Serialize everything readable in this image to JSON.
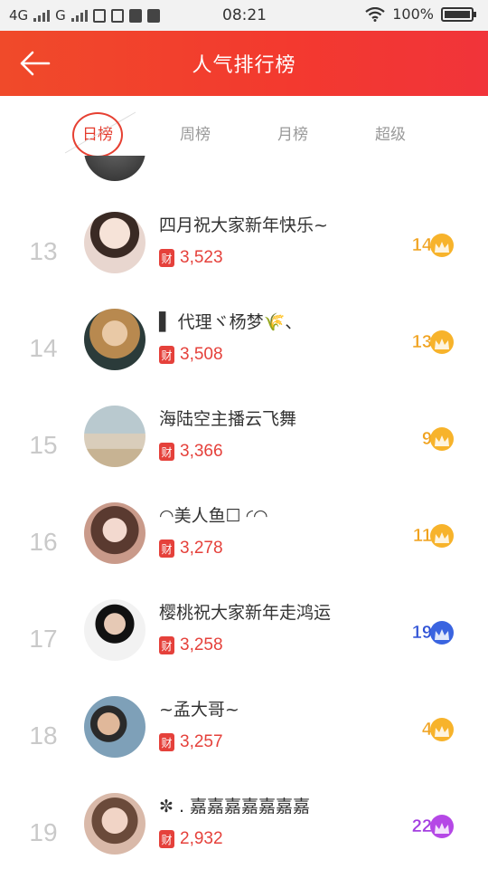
{
  "status_bar": {
    "net1": "4G",
    "net2": "G",
    "time": "08:21",
    "battery": "100%",
    "battery_level": 1.0
  },
  "header": {
    "title": "人气排行榜"
  },
  "tabs": [
    {
      "label": "日榜",
      "active": true
    },
    {
      "label": "周榜",
      "active": false
    },
    {
      "label": "月榜",
      "active": false
    },
    {
      "label": "超级",
      "active": false
    }
  ],
  "ranking": [
    {
      "rank": "13",
      "name": "四月祝大家新年快乐~",
      "value": "3,523",
      "level": "14",
      "tier": "gold"
    },
    {
      "rank": "14",
      "name": "▌ 代理ヾ杨梦🌾、",
      "value": "3,508",
      "level": "13",
      "tier": "gold"
    },
    {
      "rank": "15",
      "name": "海陆空主播云飞舞",
      "value": "3,366",
      "level": "9",
      "tier": "gold"
    },
    {
      "rank": "16",
      "name": "◠美人鱼☐ ◜◠",
      "value": "3,278",
      "level": "11",
      "tier": "gold"
    },
    {
      "rank": "17",
      "name": "樱桃祝大家新年走鸿运",
      "value": "3,258",
      "level": "19",
      "tier": "blue"
    },
    {
      "rank": "18",
      "name": "~孟大哥~",
      "value": "3,257",
      "level": "4",
      "tier": "gold"
    },
    {
      "rank": "19",
      "name": "✼ . 嘉嘉嘉嘉嘉嘉嘉",
      "value": "2,932",
      "level": "22",
      "tier": "purple"
    }
  ],
  "badge_label": "财",
  "icons": {
    "back": "arrow-left-icon",
    "crown": "crown-icon",
    "wealth": "wealth-badge-icon"
  },
  "colors": {
    "header": "#f23a2f",
    "accent": "#e5413b",
    "gold": "#f0a21e",
    "blue": "#2f52d6",
    "purple": "#a33de0"
  }
}
